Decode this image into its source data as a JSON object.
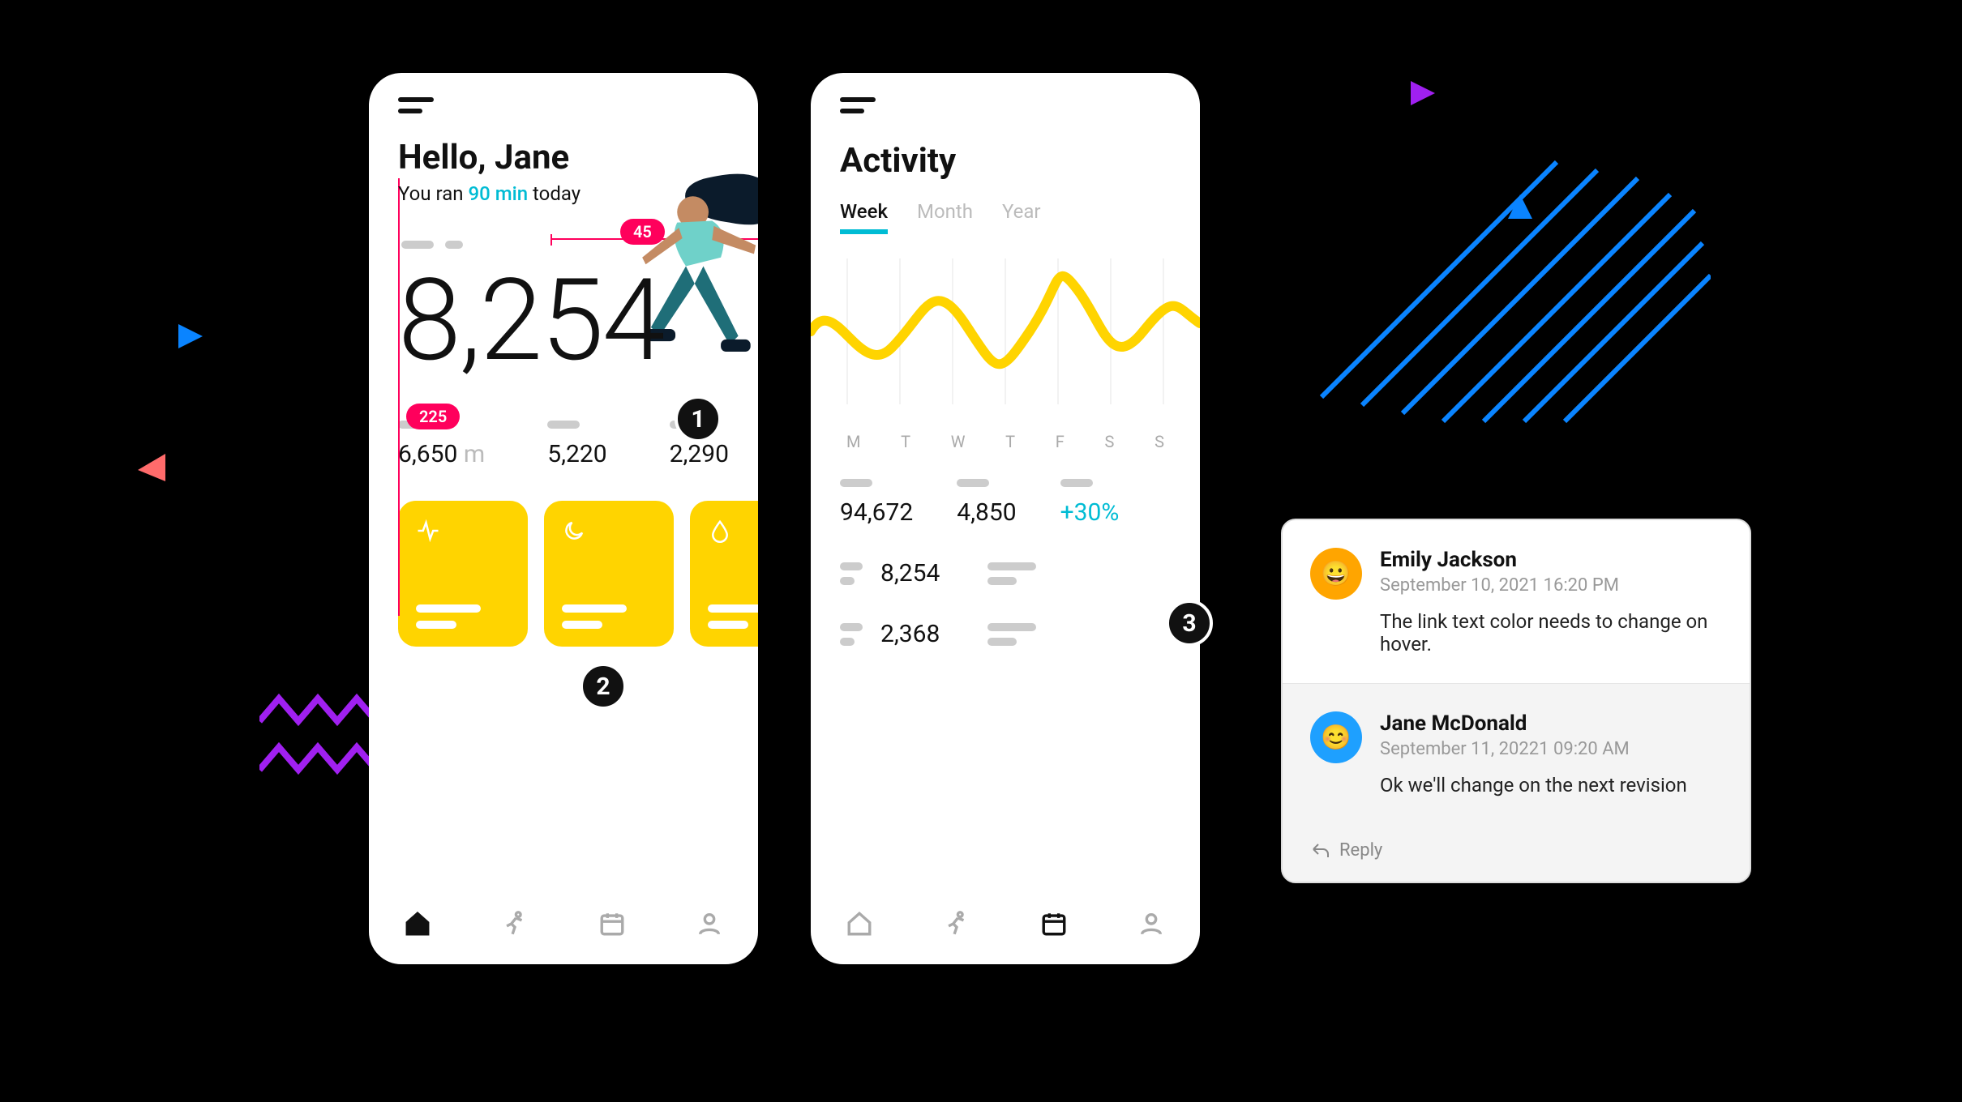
{
  "phone1": {
    "greeting": "Hello, Jane",
    "subtext_pre": "You ran ",
    "duration": "90 min",
    "subtext_post": " today",
    "bignumber": "8,254",
    "guides": {
      "h": "45",
      "v": "225"
    },
    "stats": [
      {
        "value": "6,650",
        "unit": "m"
      },
      {
        "value": "5,220",
        "unit": ""
      },
      {
        "value": "2,290",
        "unit": ""
      }
    ],
    "cards": [
      {
        "icon": "activity"
      },
      {
        "icon": "moon"
      },
      {
        "icon": "drop"
      }
    ]
  },
  "phone2": {
    "title": "Activity",
    "tabs": [
      "Week",
      "Month",
      "Year"
    ],
    "active_tab": "Week",
    "days": [
      "M",
      "T",
      "W",
      "T",
      "F",
      "S",
      "S"
    ],
    "stats": [
      {
        "value": "94,672"
      },
      {
        "value": "4,850"
      },
      {
        "value": "+30%",
        "accent": true
      }
    ],
    "list": [
      {
        "value": "8,254"
      },
      {
        "value": "2,368"
      }
    ]
  },
  "chart_data": {
    "type": "line",
    "title": "Activity",
    "xlabel": "",
    "ylabel": "",
    "categories": [
      "M",
      "T",
      "W",
      "T",
      "F",
      "S",
      "S"
    ],
    "values": [
      55,
      35,
      70,
      40,
      90,
      50,
      58
    ],
    "ylim": [
      0,
      100
    ]
  },
  "markers": {
    "m1": "1",
    "m2": "2",
    "m3": "3"
  },
  "comments": {
    "c1": {
      "name": "Emily Jackson",
      "date": "September 10, 2021 16:20 PM",
      "text": "The link text color needs to change on hover."
    },
    "c2": {
      "name": "Jane McDonald",
      "date": "September 11, 20221 09:20 AM",
      "text": "Ok we'll change on the next revision"
    },
    "reply_label": "Reply"
  }
}
